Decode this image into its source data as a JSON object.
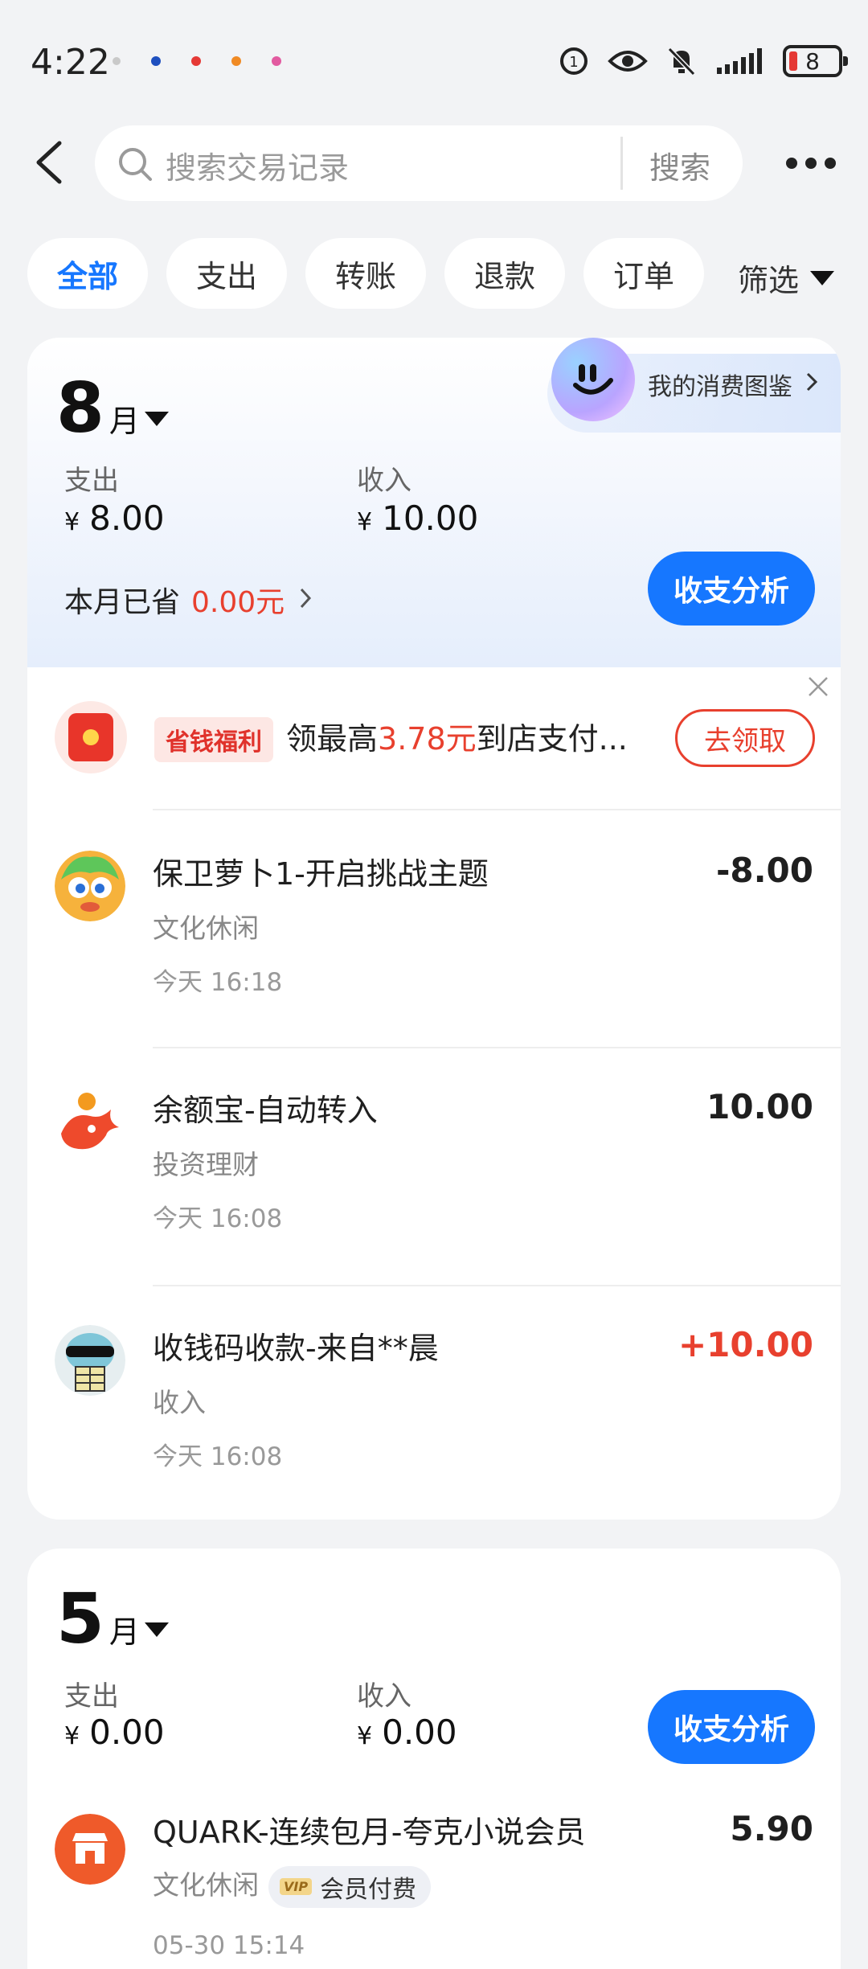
{
  "status_bar": {
    "time": "4:22",
    "battery": "8"
  },
  "search": {
    "placeholder": "搜索交易记录",
    "button": "搜索"
  },
  "filters": {
    "chips": [
      "全部",
      "支出",
      "转账",
      "退款",
      "订单"
    ],
    "filter_label": "筛选"
  },
  "months": [
    {
      "month_num": "8",
      "month_unit": "月",
      "expense_label": "支出",
      "expense_currency": "¥",
      "expense_value": "8.00",
      "income_label": "收入",
      "income_currency": "¥",
      "income_value": "10.00",
      "saved_label": "本月已省",
      "saved_value": "0.00元",
      "analysis_button": "收支分析",
      "gallery_label": "我的消费图鉴",
      "promo": {
        "badge": "省钱福利",
        "text_prefix": "领最高",
        "text_highlight": "3.78元",
        "text_suffix": "到店支付...",
        "button": "去领取"
      },
      "transactions": [
        {
          "title": "保卫萝卜1-开启挑战主题",
          "category": "文化休闲",
          "time": "今天 16:18",
          "amount": "-8.00",
          "icon": "game-character-avatar"
        },
        {
          "title": "余额宝-自动转入",
          "category": "投资理财",
          "time": "今天 16:08",
          "amount": "10.00",
          "icon": "yuebao-icon"
        },
        {
          "title": "收钱码收款-来自**晨",
          "category": "收入",
          "time": "今天 16:08",
          "amount": "+10.00",
          "icon": "user-avatar"
        }
      ]
    },
    {
      "month_num": "5",
      "month_unit": "月",
      "expense_label": "支出",
      "expense_currency": "¥",
      "expense_value": "0.00",
      "income_label": "收入",
      "income_currency": "¥",
      "income_value": "0.00",
      "analysis_button": "收支分析",
      "transactions": [
        {
          "title": "QUARK-连续包月-夸克小说会员",
          "category": "文化休闲",
          "tag_icon": "VIP",
          "tag": "会员付费",
          "time": "05-30 15:14",
          "amount": "5.90",
          "icon": "store-icon"
        }
      ]
    }
  ],
  "colors": {
    "accent": "#1677ff",
    "negative": "#e8402e",
    "background": "#f2f3f5"
  }
}
